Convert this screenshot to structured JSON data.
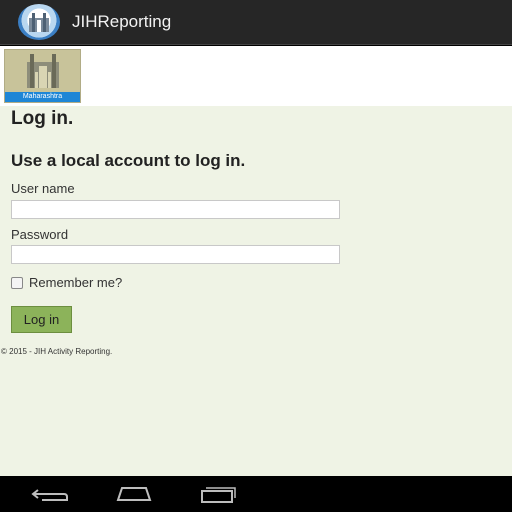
{
  "app": {
    "title": "JIHReporting"
  },
  "logo": {
    "band_text": "Maharashtra"
  },
  "login": {
    "heading": "Log in.",
    "subheading": "Use a local account to log in.",
    "username_label": "User name",
    "username_value": "",
    "password_label": "Password",
    "password_value": "",
    "remember_label": "Remember me?",
    "remember_checked": false,
    "submit_label": "Log in"
  },
  "footer": {
    "text": "© 2015 - JIH Activity Reporting."
  },
  "colors": {
    "titlebar": "#262626",
    "page_bg": "#eff3e5",
    "button_bg": "#8cb35a",
    "logo_band": "#1f86d6"
  },
  "icons": {
    "app": "jih-logo-icon",
    "nav_back": "back-icon",
    "nav_home": "home-icon",
    "nav_recent": "recent-apps-icon"
  }
}
